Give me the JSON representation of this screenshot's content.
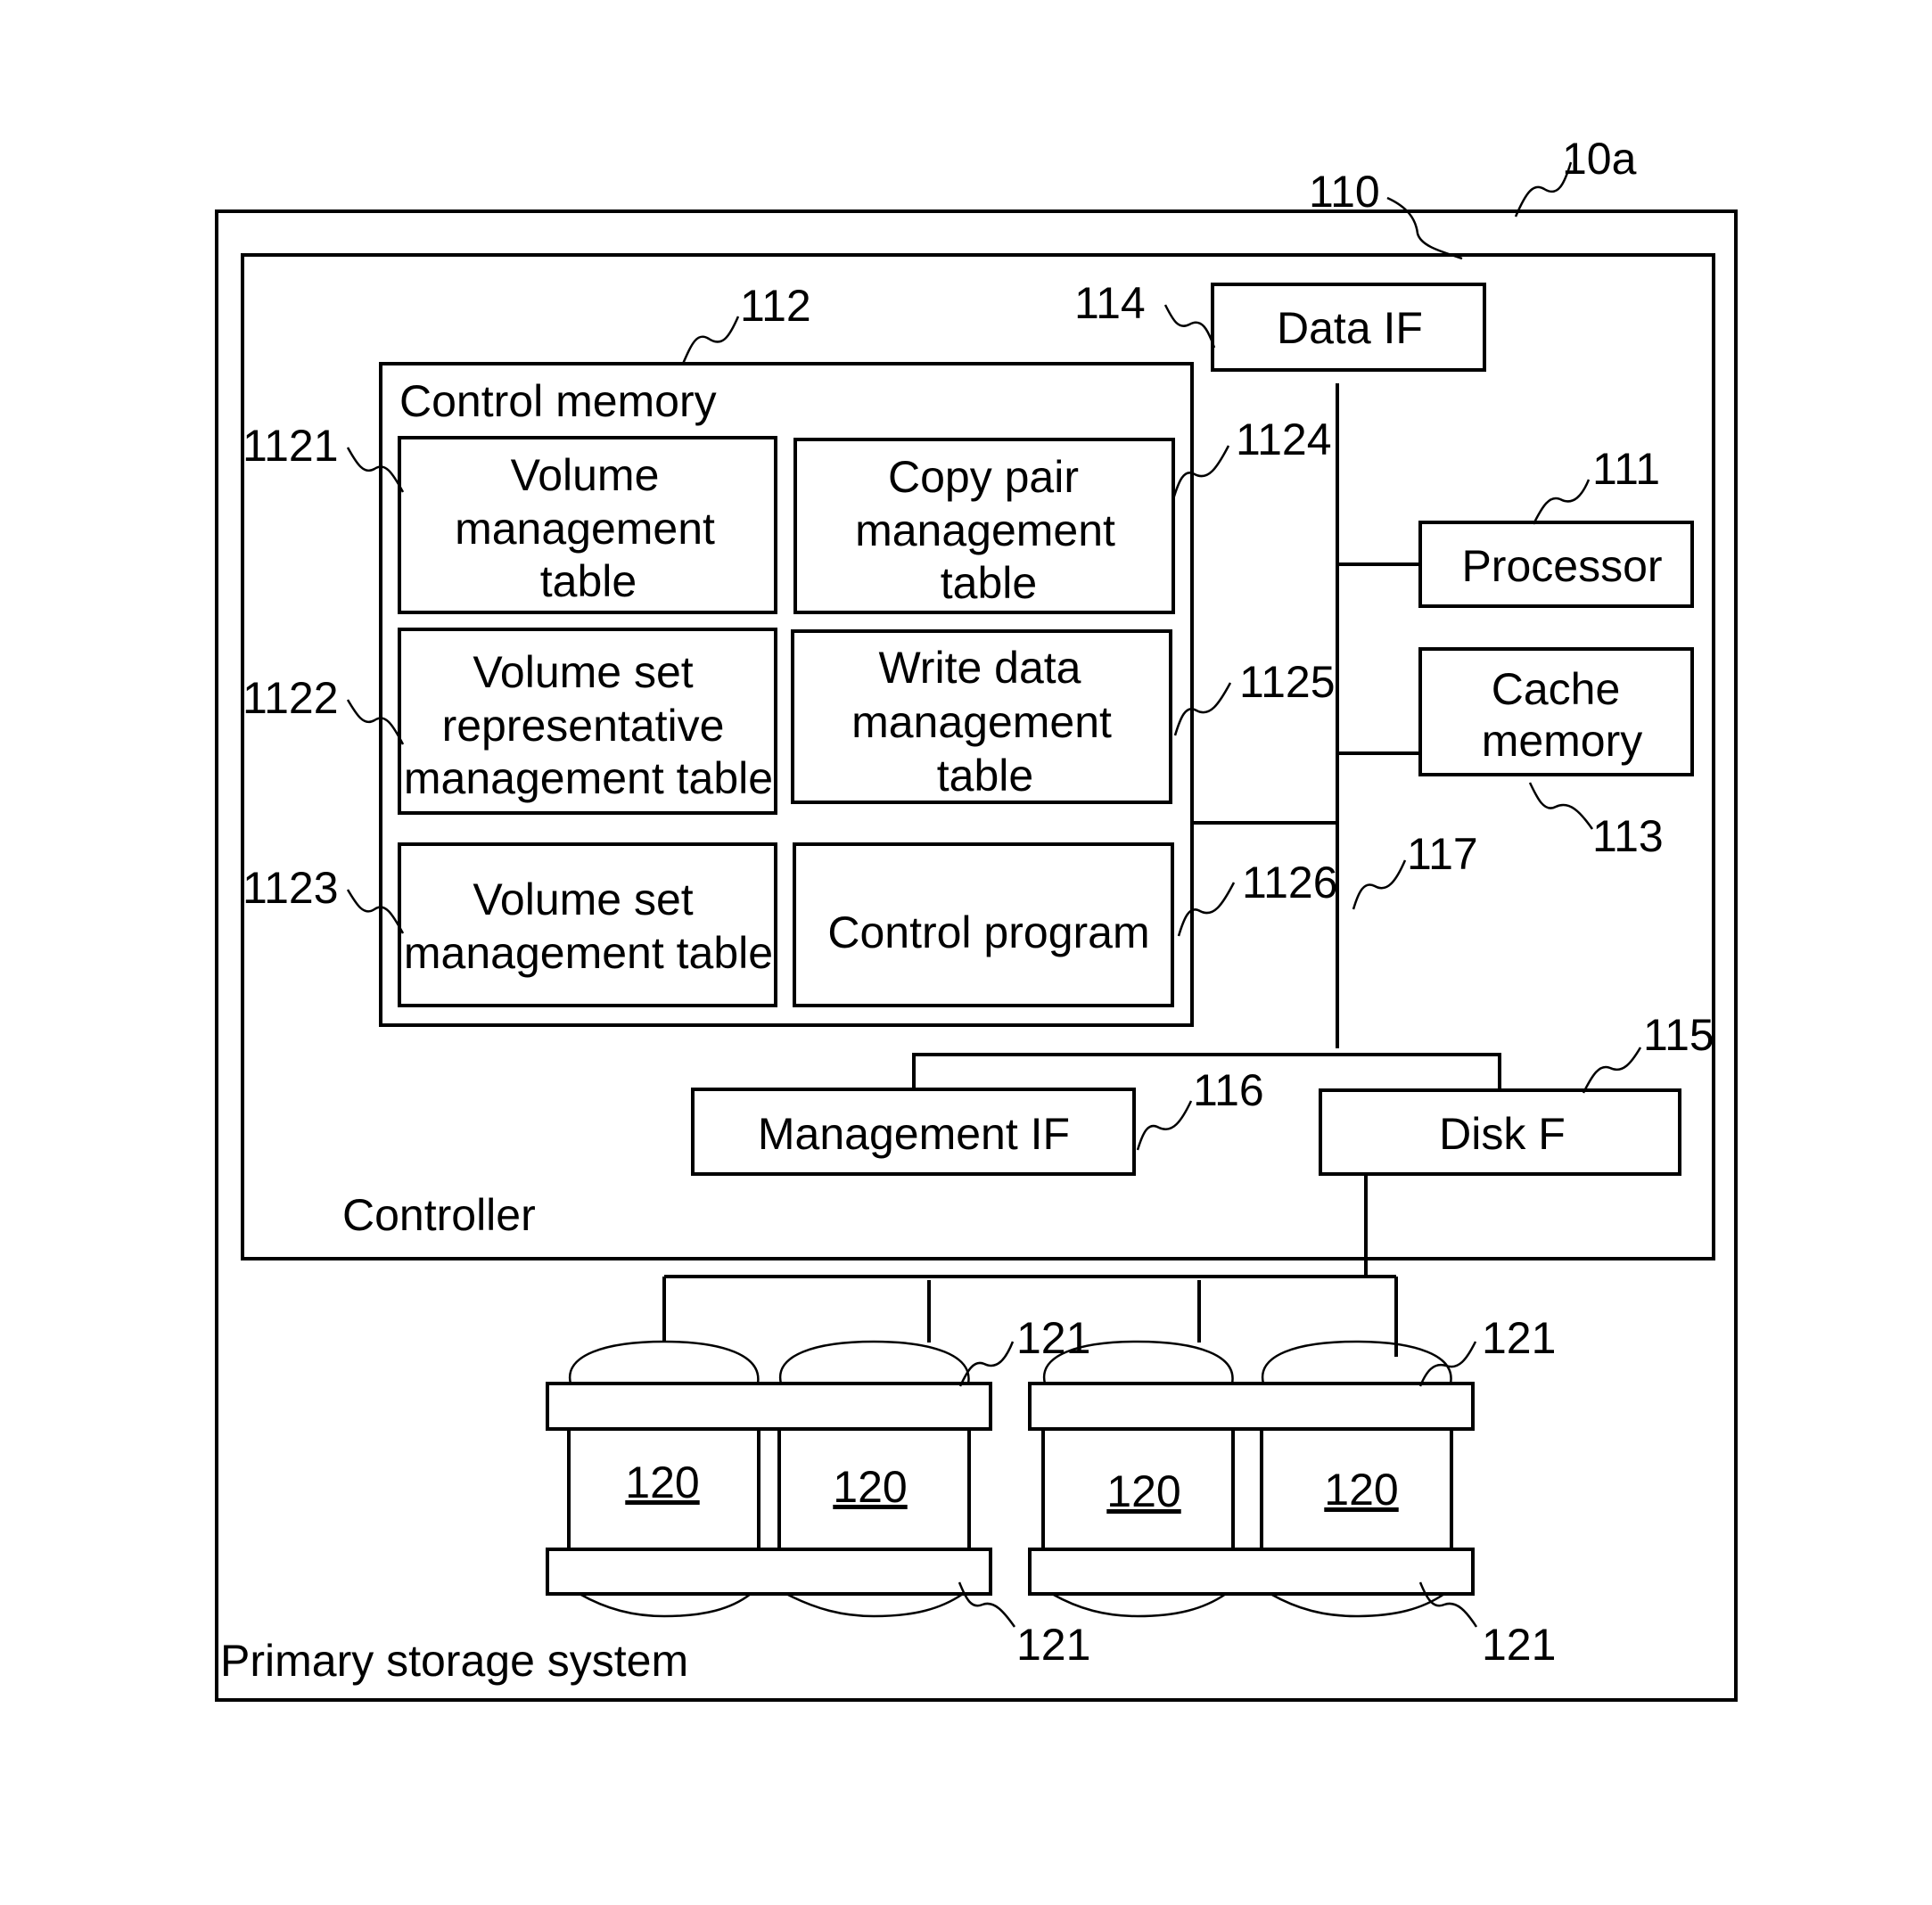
{
  "figure": {
    "system": {
      "ref": "10a",
      "label": "Primary storage system"
    },
    "controller": {
      "ref": "110",
      "label": "Controller"
    },
    "control_memory": {
      "ref": "112",
      "label": "Control memory",
      "tables": [
        {
          "ref": "1121",
          "lines": [
            "Volume",
            "management",
            "table"
          ]
        },
        {
          "ref": "1122",
          "lines": [
            "Volume set",
            "representative",
            "management table"
          ]
        },
        {
          "ref": "1123",
          "lines": [
            "Volume set",
            "management table"
          ]
        },
        {
          "ref": "1124",
          "lines": [
            "Copy pair",
            "management",
            "table"
          ]
        },
        {
          "ref": "1125",
          "lines": [
            "Write data",
            "management",
            "table"
          ]
        },
        {
          "ref": "1126",
          "lines": [
            "Control program"
          ]
        }
      ]
    },
    "data_if": {
      "ref": "114",
      "label": "Data IF"
    },
    "processor": {
      "ref": "111",
      "label": "Processor"
    },
    "cache_memory": {
      "ref": "113",
      "lines": [
        "Cache",
        "memory"
      ]
    },
    "bus": {
      "ref": "117"
    },
    "management_if": {
      "ref": "116",
      "label": "Management IF"
    },
    "disk_if": {
      "ref": "115",
      "label": "Disk F"
    },
    "disks": [
      {
        "ref": "120"
      },
      {
        "ref": "120"
      },
      {
        "ref": "120"
      },
      {
        "ref": "120"
      }
    ],
    "disk_group_refs": [
      "121",
      "121",
      "121",
      "121"
    ]
  }
}
